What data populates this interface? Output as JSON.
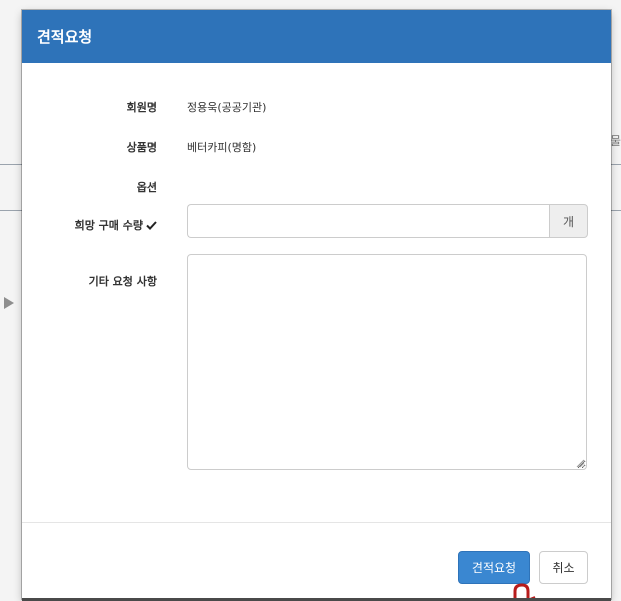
{
  "modal": {
    "title": "견적요청"
  },
  "form": {
    "member_label": "회원명",
    "member_value": "정용욱(공공기관)",
    "product_label": "상품명",
    "product_value": "베터카피(명함)",
    "option_label": "옵션",
    "quantity_label": "희망 구매 수량",
    "quantity_value": "",
    "quantity_unit": "개",
    "notes_label": "기타 요청 사항",
    "notes_value": ""
  },
  "footer": {
    "submit_label": "견적요청",
    "cancel_label": "취소"
  },
  "background": {
    "right_edge_text": "물"
  },
  "colors": {
    "header": "#2e73b9",
    "primary_button": "#3a87d1"
  }
}
